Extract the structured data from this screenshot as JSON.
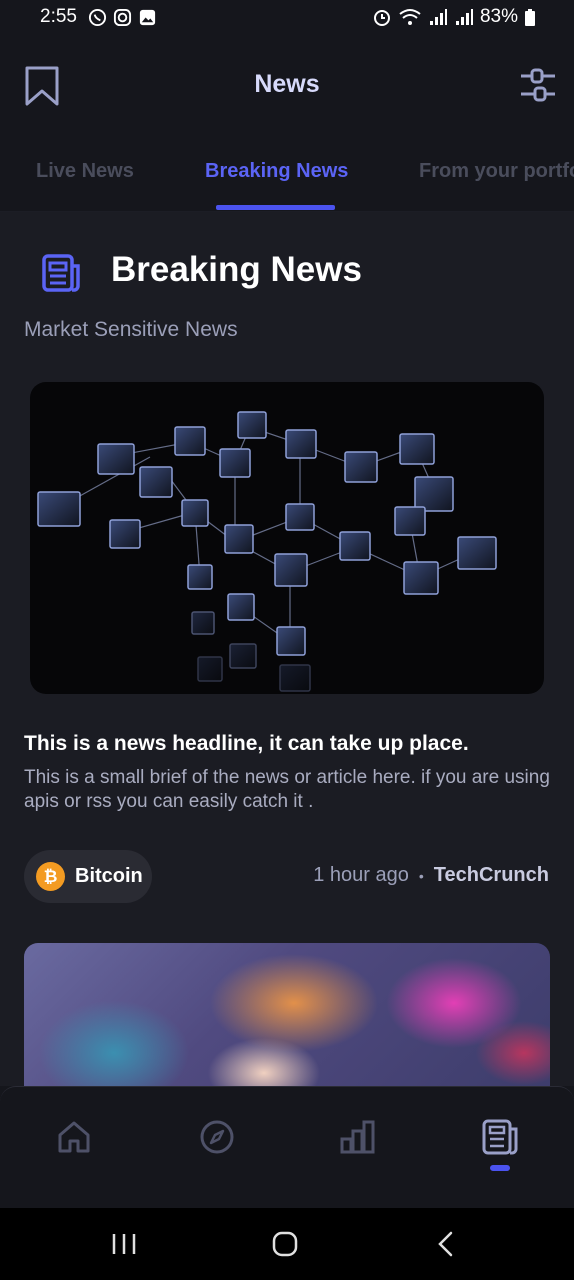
{
  "status_bar": {
    "time": "2:55",
    "battery": "83%"
  },
  "header": {
    "title": "News"
  },
  "tabs": [
    {
      "label": "Live News",
      "active": false
    },
    {
      "label": "Breaking News",
      "active": true
    },
    {
      "label": "From your portfo",
      "active": false
    }
  ],
  "section": {
    "title": "Breaking News",
    "subtitle": "Market Sensitive News"
  },
  "article": {
    "headline": "This is a news headline, it can take up place.",
    "brief": "This is a small brief of the news or article here. if you are using apis or rss you can easily catch it .",
    "tag": "Bitcoin",
    "tag_icon": "bitcoin-icon",
    "time_ago": "1 hour ago",
    "separator": "•",
    "source": "TechCrunch"
  },
  "bottom_nav": {
    "items": [
      "home-icon",
      "compass-icon",
      "bar-chart-icon",
      "newspaper-icon"
    ],
    "active_index": 3
  },
  "colors": {
    "accent": "#4b53ef",
    "background": "#1b1c23",
    "header_bg": "#15161c",
    "bitcoin": "#f39b22"
  }
}
